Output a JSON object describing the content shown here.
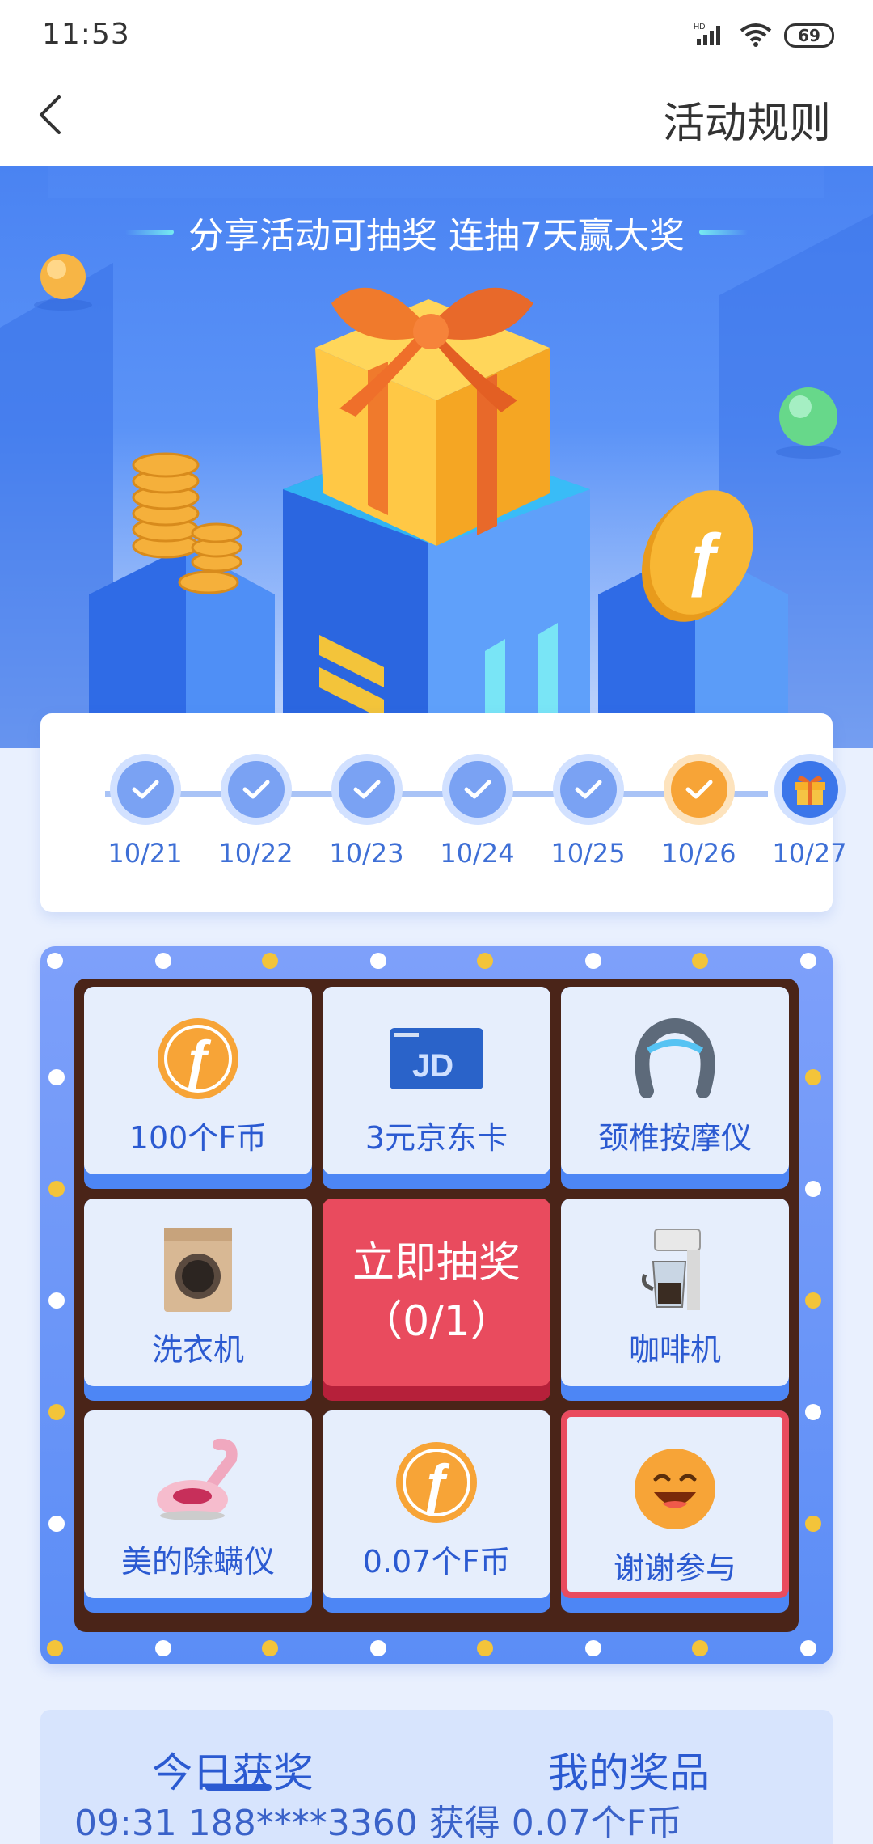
{
  "status_bar": {
    "time": "11:53",
    "battery": "69",
    "network": "HD"
  },
  "nav": {
    "title": "活动规则"
  },
  "hero": {
    "headline": "分享活动可抽奖 连抽7天赢大奖"
  },
  "checkin": {
    "days": [
      {
        "date": "10/21",
        "state": "done"
      },
      {
        "date": "10/22",
        "state": "done"
      },
      {
        "date": "10/23",
        "state": "done"
      },
      {
        "date": "10/24",
        "state": "done"
      },
      {
        "date": "10/25",
        "state": "done"
      },
      {
        "date": "10/26",
        "state": "today"
      },
      {
        "date": "10/27",
        "state": "gift"
      }
    ]
  },
  "lottery": {
    "prizes": [
      {
        "label": "100个F币",
        "icon": "f-coin-icon"
      },
      {
        "label": "3元京东卡",
        "icon": "jd-card-icon"
      },
      {
        "label": "颈椎按摩仪",
        "icon": "neck-massager-icon"
      },
      {
        "label": "洗衣机",
        "icon": "washing-machine-icon"
      },
      {
        "label": "咖啡机",
        "icon": "coffee-machine-icon"
      },
      {
        "label": "美的除螨仪",
        "icon": "mite-remover-icon"
      },
      {
        "label": "0.07个F币",
        "icon": "f-coin-icon"
      },
      {
        "label": "谢谢参与",
        "icon": "smile-face-icon"
      }
    ],
    "draw_button": {
      "line1": "立即抽奖",
      "line2": "（0/1）"
    }
  },
  "records": {
    "tabs": [
      "今日获奖",
      "我的奖品"
    ],
    "latest": "09:31 188****3360 获得 0.07个F币"
  },
  "colors": {
    "primary": "#4d86f5",
    "draw": "#e94b5e",
    "coin": "#f7a437",
    "board": "#4a2418"
  }
}
